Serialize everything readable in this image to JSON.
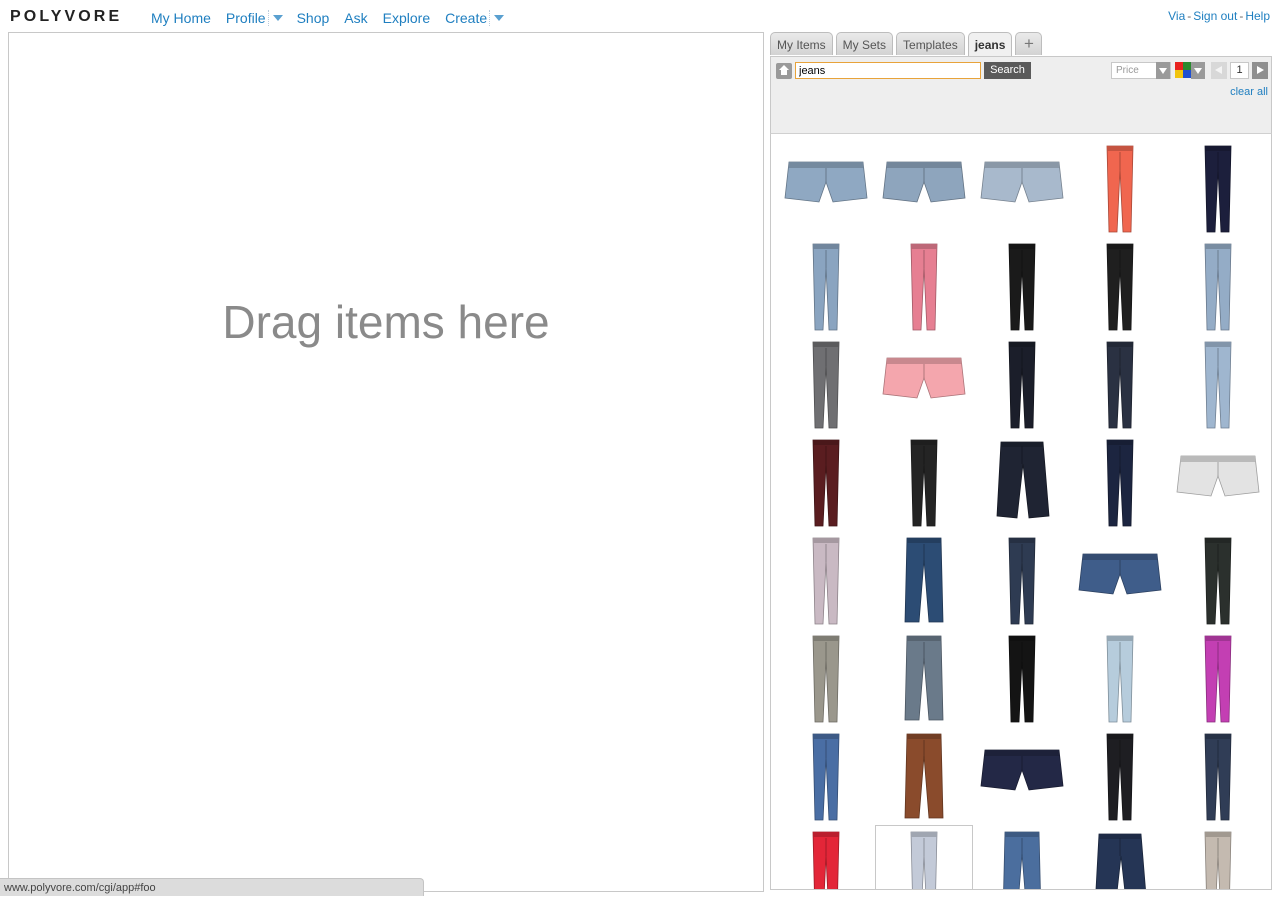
{
  "header": {
    "logo": "POLYVORE",
    "nav": [
      {
        "label": "My Home"
      },
      {
        "label": "Profile",
        "dropdown": true
      },
      {
        "label": "Shop"
      },
      {
        "label": "Ask"
      },
      {
        "label": "Explore"
      },
      {
        "label": "Create",
        "dropdown": true
      }
    ],
    "links": [
      "Via",
      "Sign out",
      "Help"
    ]
  },
  "canvas": {
    "hint": "Drag items here"
  },
  "panel": {
    "tabs": [
      {
        "label": "My Items",
        "active": false
      },
      {
        "label": "My Sets",
        "active": false
      },
      {
        "label": "Templates",
        "active": false
      },
      {
        "label": "jeans",
        "active": true
      },
      {
        "label": "+",
        "active": false
      }
    ],
    "search": {
      "value": "jeans",
      "button": "Search"
    },
    "price_placeholder": "Price",
    "page": "1",
    "clear_all": "clear all"
  },
  "items": [
    {
      "type": "shorts",
      "color": "#8fa8c2"
    },
    {
      "type": "shorts",
      "color": "#8ea5bd"
    },
    {
      "type": "shorts",
      "color": "#a8b9cc"
    },
    {
      "type": "skinny",
      "color": "#f0664f"
    },
    {
      "type": "skinny",
      "color": "#1c1f3c"
    },
    {
      "type": "skinny",
      "color": "#8aa4c0"
    },
    {
      "type": "skinny",
      "color": "#e67f92"
    },
    {
      "type": "skinny",
      "color": "#1a1a1a"
    },
    {
      "type": "skinny",
      "color": "#1f1f1f"
    },
    {
      "type": "skinny",
      "color": "#94acc6"
    },
    {
      "type": "skinny",
      "color": "#6f6f72"
    },
    {
      "type": "shorts",
      "color": "#f4a6ad"
    },
    {
      "type": "skinny",
      "color": "#1b1e2a"
    },
    {
      "type": "skinny",
      "color": "#2a3142"
    },
    {
      "type": "skinny",
      "color": "#9fb6cf"
    },
    {
      "type": "skinny",
      "color": "#5a1d20"
    },
    {
      "type": "skinny",
      "color": "#242424"
    },
    {
      "type": "capri",
      "color": "#1f2433"
    },
    {
      "type": "skinny",
      "color": "#1c2540"
    },
    {
      "type": "shorts",
      "color": "#e3e3e3"
    },
    {
      "type": "skinny",
      "color": "#c9b9c3"
    },
    {
      "type": "straight",
      "color": "#2c4c74"
    },
    {
      "type": "skinny",
      "color": "#2e3b52"
    },
    {
      "type": "shorts",
      "color": "#3f5d8a"
    },
    {
      "type": "skinny",
      "color": "#2b302d"
    },
    {
      "type": "skinny",
      "color": "#9a978c"
    },
    {
      "type": "straight",
      "color": "#6a7a8a"
    },
    {
      "type": "skinny",
      "color": "#141414"
    },
    {
      "type": "skinny",
      "color": "#b6ccdc"
    },
    {
      "type": "skinny",
      "color": "#c33fb3"
    },
    {
      "type": "skinny",
      "color": "#4a6ea4"
    },
    {
      "type": "straight",
      "color": "#8a4b2c"
    },
    {
      "type": "shorts",
      "color": "#232846"
    },
    {
      "type": "skinny",
      "color": "#1e1e22"
    },
    {
      "type": "skinny",
      "color": "#303d56"
    },
    {
      "type": "skinny",
      "color": "#e32638"
    },
    {
      "type": "skinny",
      "color": "#c3cad8",
      "selected": true
    },
    {
      "type": "straight",
      "color": "#4b6e9e"
    },
    {
      "type": "capri",
      "color": "#253555"
    },
    {
      "type": "skinny",
      "color": "#c4bab0"
    }
  ],
  "status": "www.polyvore.com/cgi/app#foo"
}
